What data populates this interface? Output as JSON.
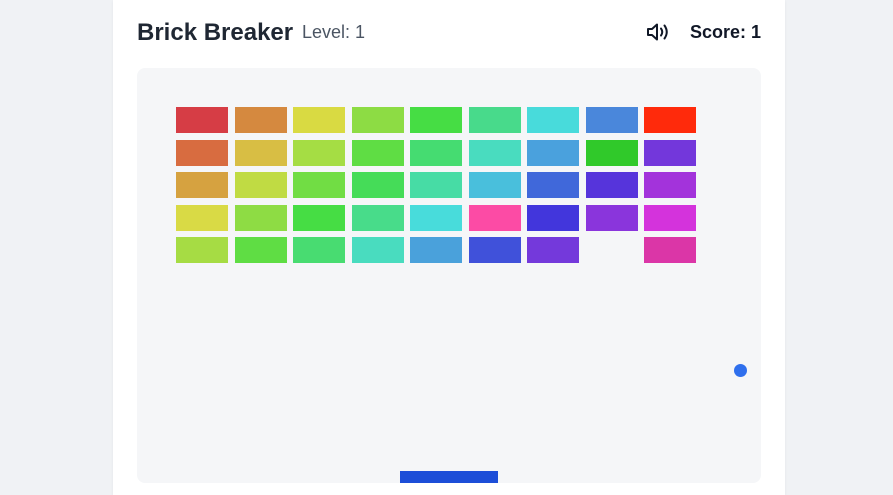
{
  "header": {
    "title": "Brick Breaker",
    "level_text": "Level: 1",
    "score_text": "Score: 1",
    "sound_icon": "speaker-volume-icon"
  },
  "game": {
    "level": 1,
    "score": 1,
    "colors": {
      "ball": "#2f6fed",
      "paddle": "#1d4ed8",
      "board_bg": "#f5f6f8"
    },
    "brick_grid": [
      [
        "#d63d45",
        "#d5893f",
        "#d9da42",
        "#8ddc44",
        "#46dd44",
        "#48da8b",
        "#48dbdb",
        "#4a87db",
        "#ff2a0b"
      ],
      [
        "#d86c40",
        "#d8be44",
        "#a5dd44",
        "#5fdd44",
        "#45dc71",
        "#49dcbf",
        "#4aa1dd",
        "#30c92a",
        "#7337db"
      ],
      [
        "#d6a240",
        "#c0db43",
        "#71dd44",
        "#45dc58",
        "#47dca5",
        "#49bfdc",
        "#4068da",
        "#5634db",
        "#a333db"
      ],
      [
        "#d9da45",
        "#8edc44",
        "#46dd44",
        "#48dc8a",
        "#48dcdb",
        "#fc4ba5",
        "#4236dc",
        "#8a35dc",
        "#d433dc"
      ],
      [
        "#a6dc44",
        "#5fdd44",
        "#48dc71",
        "#49dcbf",
        "#4aa1db",
        "#4051da",
        "#7439db",
        null,
        "#db36a7"
      ]
    ]
  }
}
